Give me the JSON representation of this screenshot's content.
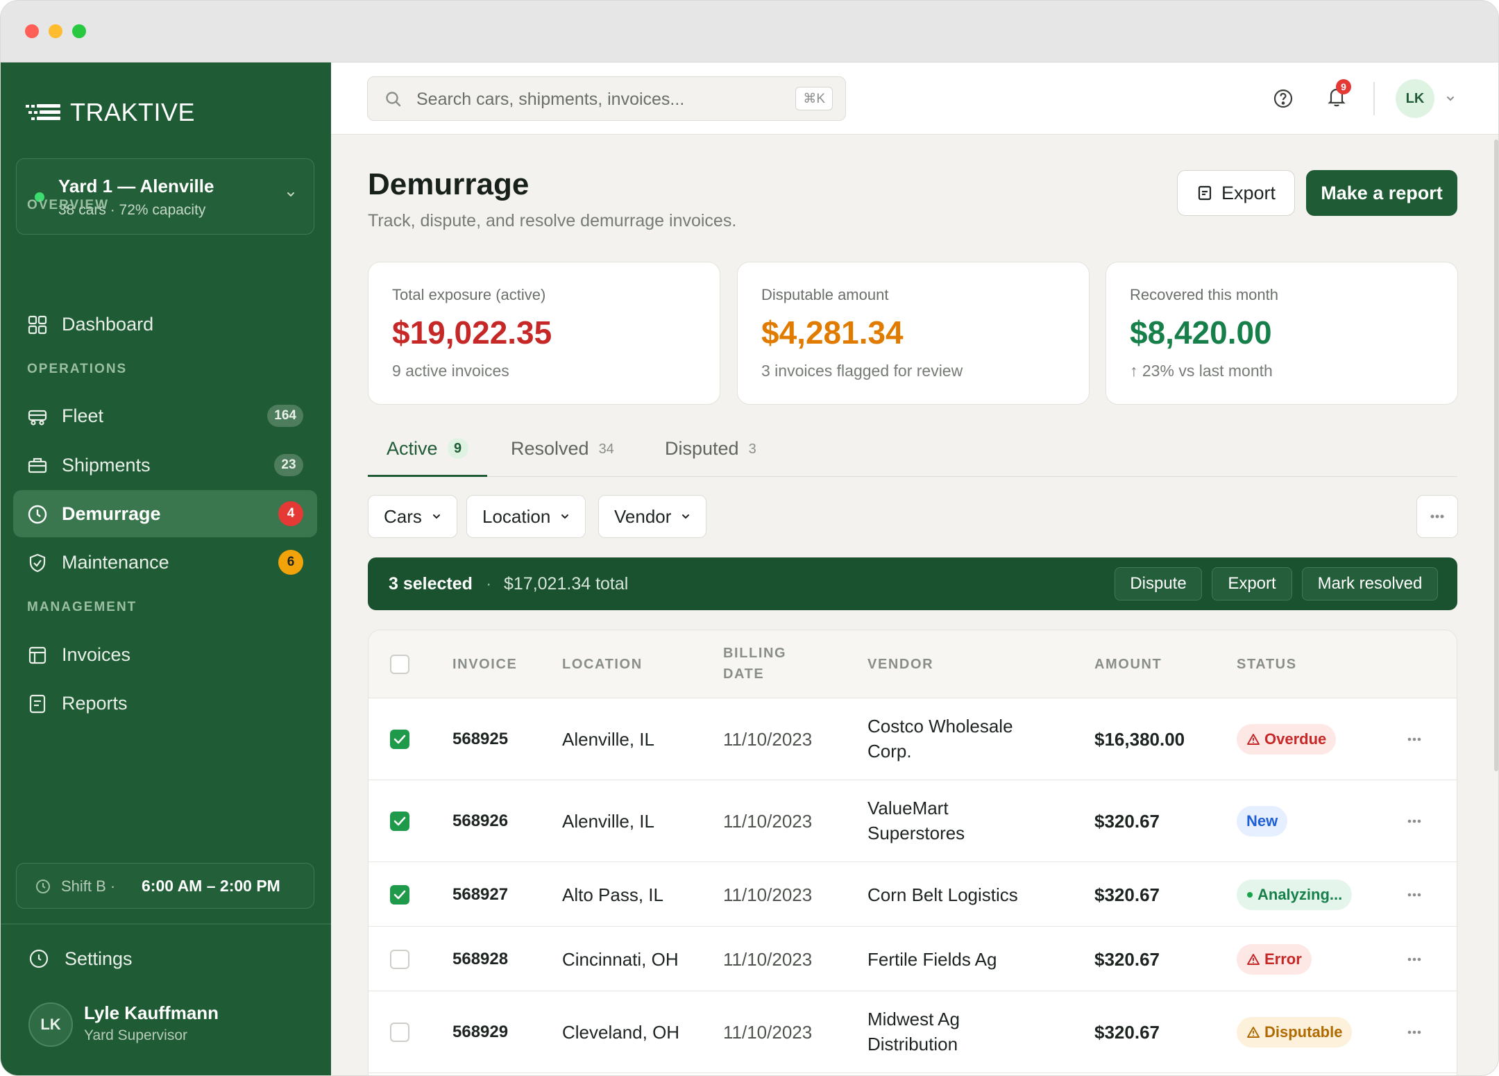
{
  "brand": {
    "name": "TRAKTIVE"
  },
  "yard": {
    "name": "Yard 1 — Alenville",
    "sub": "38 cars · 72% capacity"
  },
  "sidebar": {
    "sections": {
      "overview": "OVERVIEW",
      "operations": "OPERATIONS",
      "management": "MANAGEMENT"
    },
    "items": [
      {
        "label": "Dashboard",
        "icon": "grid-icon"
      },
      {
        "label": "Fleet",
        "icon": "train-icon",
        "badge": "164"
      },
      {
        "label": "Shipments",
        "icon": "box-icon",
        "badge": "23"
      },
      {
        "label": "Demurrage",
        "icon": "clock-icon",
        "badge": "4",
        "active": true
      },
      {
        "label": "Maintenance",
        "icon": "shield-check-icon",
        "badge": "6"
      },
      {
        "label": "Invoices",
        "icon": "invoice-icon"
      },
      {
        "label": "Reports",
        "icon": "report-icon"
      }
    ],
    "shift": {
      "label": "Shift B ·",
      "time": "6:00 AM – 2:00 PM"
    },
    "settings": "Settings",
    "user": {
      "initials": "LK",
      "name": "Lyle Kauffmann",
      "role": "Yard Supervisor"
    }
  },
  "topbar": {
    "search_placeholder": "Search cars, shipments, invoices...",
    "shortcut": "⌘K",
    "notifications": "9",
    "user_initials": "LK"
  },
  "page": {
    "title": "Demurrage",
    "subtitle": "Track, dispute, and resolve demurrage invoices.",
    "export_label": "Export",
    "report_label": "Make a report"
  },
  "cards": [
    {
      "label": "Total exposure (active)",
      "value": "$19,022.35",
      "sub": "9 active invoices",
      "color": "#c62828"
    },
    {
      "label": "Disputable amount",
      "value": "$4,281.34",
      "sub": "3 invoices flagged for review",
      "color": "#e07b00"
    },
    {
      "label": "Recovered this month",
      "value": "$8,420.00",
      "sub": "↑ 23% vs last month",
      "color": "#17804a"
    }
  ],
  "tabs": [
    {
      "label": "Active",
      "count": "9"
    },
    {
      "label": "Resolved",
      "count": "34"
    },
    {
      "label": "Disputed",
      "count": "3"
    }
  ],
  "filters": [
    "Cars",
    "Location",
    "Vendor"
  ],
  "selection": {
    "count": "3 selected",
    "separator": "·",
    "total": "$17,021.34 total",
    "actions": [
      "Dispute",
      "Export",
      "Mark resolved"
    ]
  },
  "table": {
    "headers": [
      "INVOICE",
      "LOCATION",
      "BILLING",
      "DATE",
      "VENDOR",
      "AMOUNT",
      "STATUS"
    ],
    "rows": [
      {
        "invoice": "568925",
        "location": "Alenville, IL",
        "date": "11/10/2023",
        "vendor1": "Costco Wholesale",
        "vendor2": "Corp.",
        "amount": "$16,380.00",
        "status": "Overdue",
        "checked": true
      },
      {
        "invoice": "568926",
        "location": "Alenville, IL",
        "date": "11/10/2023",
        "vendor1": "ValueMart",
        "vendor2": "Superstores",
        "amount": "$320.67",
        "status": "New",
        "checked": true
      },
      {
        "invoice": "568927",
        "location": "Alto Pass, IL",
        "date": "11/10/2023",
        "vendor1": "Corn Belt Logistics",
        "vendor2": "",
        "amount": "$320.67",
        "status": "Analyzing...",
        "checked": true
      },
      {
        "invoice": "568928",
        "location": "Cincinnati, OH",
        "date": "11/10/2023",
        "vendor1": "Fertile Fields Ag",
        "vendor2": "",
        "amount": "$320.67",
        "status": "Error",
        "checked": false
      },
      {
        "invoice": "568929",
        "location": "Cleveland, OH",
        "date": "11/10/2023",
        "vendor1": "Midwest Ag",
        "vendor2": "Distribution",
        "amount": "$320.67",
        "status": "Disputable",
        "checked": false
      }
    ]
  },
  "colors": {
    "brand_green": "#1f5b35",
    "accent_green": "#1f9a4a",
    "danger": "#e53935"
  }
}
